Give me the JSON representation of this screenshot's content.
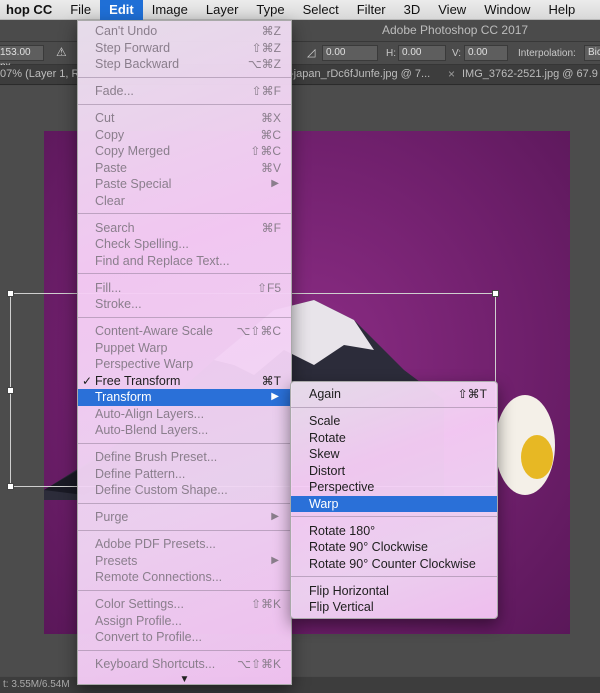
{
  "menubar": {
    "app": "hop CC",
    "items": [
      "File",
      "Edit",
      "Image",
      "Layer",
      "Type",
      "Select",
      "Filter",
      "3D",
      "View",
      "Window",
      "Help"
    ]
  },
  "optionsbar": {
    "title": "Adobe Photoshop CC 2017",
    "width_value": "153.00 px",
    "angle_value": "0.00",
    "h_label": "H:",
    "h_value": "0.00",
    "v_label": "V:",
    "v_value": "0.00",
    "interp_label": "Interpolation:",
    "interp_value": "Bic"
  },
  "tabs": {
    "tab1": "07% (Layer 1, R",
    "tab2": "-japan_rDc6fJunfe.jpg @ 7...",
    "tab3": "IMG_3762-2521.jpg @ 67.9"
  },
  "status": {
    "doc_size": "t: 3.55M/6.54M"
  },
  "edit_menu": {
    "groups": [
      [
        {
          "label": "Can't Undo",
          "shortcut": "⌘Z",
          "state": "disabled"
        },
        {
          "label": "Step Forward",
          "shortcut": "⇧⌘Z",
          "state": "disabled"
        },
        {
          "label": "Step Backward",
          "shortcut": "⌥⌘Z",
          "state": "disabled"
        }
      ],
      [
        {
          "label": "Fade...",
          "shortcut": "⇧⌘F",
          "state": "disabled"
        }
      ],
      [
        {
          "label": "Cut",
          "shortcut": "⌘X",
          "state": "disabled"
        },
        {
          "label": "Copy",
          "shortcut": "⌘C",
          "state": "disabled"
        },
        {
          "label": "Copy Merged",
          "shortcut": "⇧⌘C",
          "state": "disabled"
        },
        {
          "label": "Paste",
          "shortcut": "⌘V",
          "state": "disabled"
        },
        {
          "label": "Paste Special",
          "shortcut": "",
          "state": "disabled",
          "submenu": true
        },
        {
          "label": "Clear",
          "shortcut": "",
          "state": "disabled"
        }
      ],
      [
        {
          "label": "Search",
          "shortcut": "⌘F",
          "state": "disabled"
        },
        {
          "label": "Check Spelling...",
          "shortcut": "",
          "state": "disabled"
        },
        {
          "label": "Find and Replace Text...",
          "shortcut": "",
          "state": "disabled"
        }
      ],
      [
        {
          "label": "Fill...",
          "shortcut": "⇧F5",
          "state": "disabled"
        },
        {
          "label": "Stroke...",
          "shortcut": "",
          "state": "disabled"
        }
      ],
      [
        {
          "label": "Content-Aware Scale",
          "shortcut": "⌥⇧⌘C",
          "state": "disabled"
        },
        {
          "label": "Puppet Warp",
          "shortcut": "",
          "state": "disabled"
        },
        {
          "label": "Perspective Warp",
          "shortcut": "",
          "state": "disabled"
        },
        {
          "label": "Free Transform",
          "shortcut": "⌘T",
          "state": "enabled",
          "checked": true
        },
        {
          "label": "Transform",
          "shortcut": "",
          "state": "highlighted",
          "submenu": true
        },
        {
          "label": "Auto-Align Layers...",
          "shortcut": "",
          "state": "disabled"
        },
        {
          "label": "Auto-Blend Layers...",
          "shortcut": "",
          "state": "disabled"
        }
      ],
      [
        {
          "label": "Define Brush Preset...",
          "shortcut": "",
          "state": "disabled"
        },
        {
          "label": "Define Pattern...",
          "shortcut": "",
          "state": "disabled"
        },
        {
          "label": "Define Custom Shape...",
          "shortcut": "",
          "state": "disabled"
        }
      ],
      [
        {
          "label": "Purge",
          "shortcut": "",
          "state": "disabled",
          "submenu": true
        }
      ],
      [
        {
          "label": "Adobe PDF Presets...",
          "shortcut": "",
          "state": "disabled"
        },
        {
          "label": "Presets",
          "shortcut": "",
          "state": "disabled",
          "submenu": true
        },
        {
          "label": "Remote Connections...",
          "shortcut": "",
          "state": "disabled"
        }
      ],
      [
        {
          "label": "Color Settings...",
          "shortcut": "⇧⌘K",
          "state": "disabled"
        },
        {
          "label": "Assign Profile...",
          "shortcut": "",
          "state": "disabled"
        },
        {
          "label": "Convert to Profile...",
          "shortcut": "",
          "state": "disabled"
        }
      ],
      [
        {
          "label": "Keyboard Shortcuts...",
          "shortcut": "⌥⇧⌘K",
          "state": "disabled"
        }
      ]
    ],
    "more_arrow": "▼"
  },
  "transform_menu": {
    "groups": [
      [
        {
          "label": "Again",
          "shortcut": "⇧⌘T",
          "state": "enabled"
        }
      ],
      [
        {
          "label": "Scale",
          "shortcut": "",
          "state": "enabled"
        },
        {
          "label": "Rotate",
          "shortcut": "",
          "state": "enabled"
        },
        {
          "label": "Skew",
          "shortcut": "",
          "state": "enabled"
        },
        {
          "label": "Distort",
          "shortcut": "",
          "state": "enabled"
        },
        {
          "label": "Perspective",
          "shortcut": "",
          "state": "enabled"
        },
        {
          "label": "Warp",
          "shortcut": "",
          "state": "highlighted"
        }
      ],
      [
        {
          "label": "Rotate 180°",
          "shortcut": "",
          "state": "enabled"
        },
        {
          "label": "Rotate 90° Clockwise",
          "shortcut": "",
          "state": "enabled"
        },
        {
          "label": "Rotate 90° Counter Clockwise",
          "shortcut": "",
          "state": "enabled"
        }
      ],
      [
        {
          "label": "Flip Horizontal",
          "shortcut": "",
          "state": "enabled"
        },
        {
          "label": "Flip Vertical",
          "shortcut": "",
          "state": "enabled"
        }
      ]
    ]
  },
  "colors": {
    "highlight": "#2a70d8",
    "canvas_magenta": "#7a2477"
  }
}
